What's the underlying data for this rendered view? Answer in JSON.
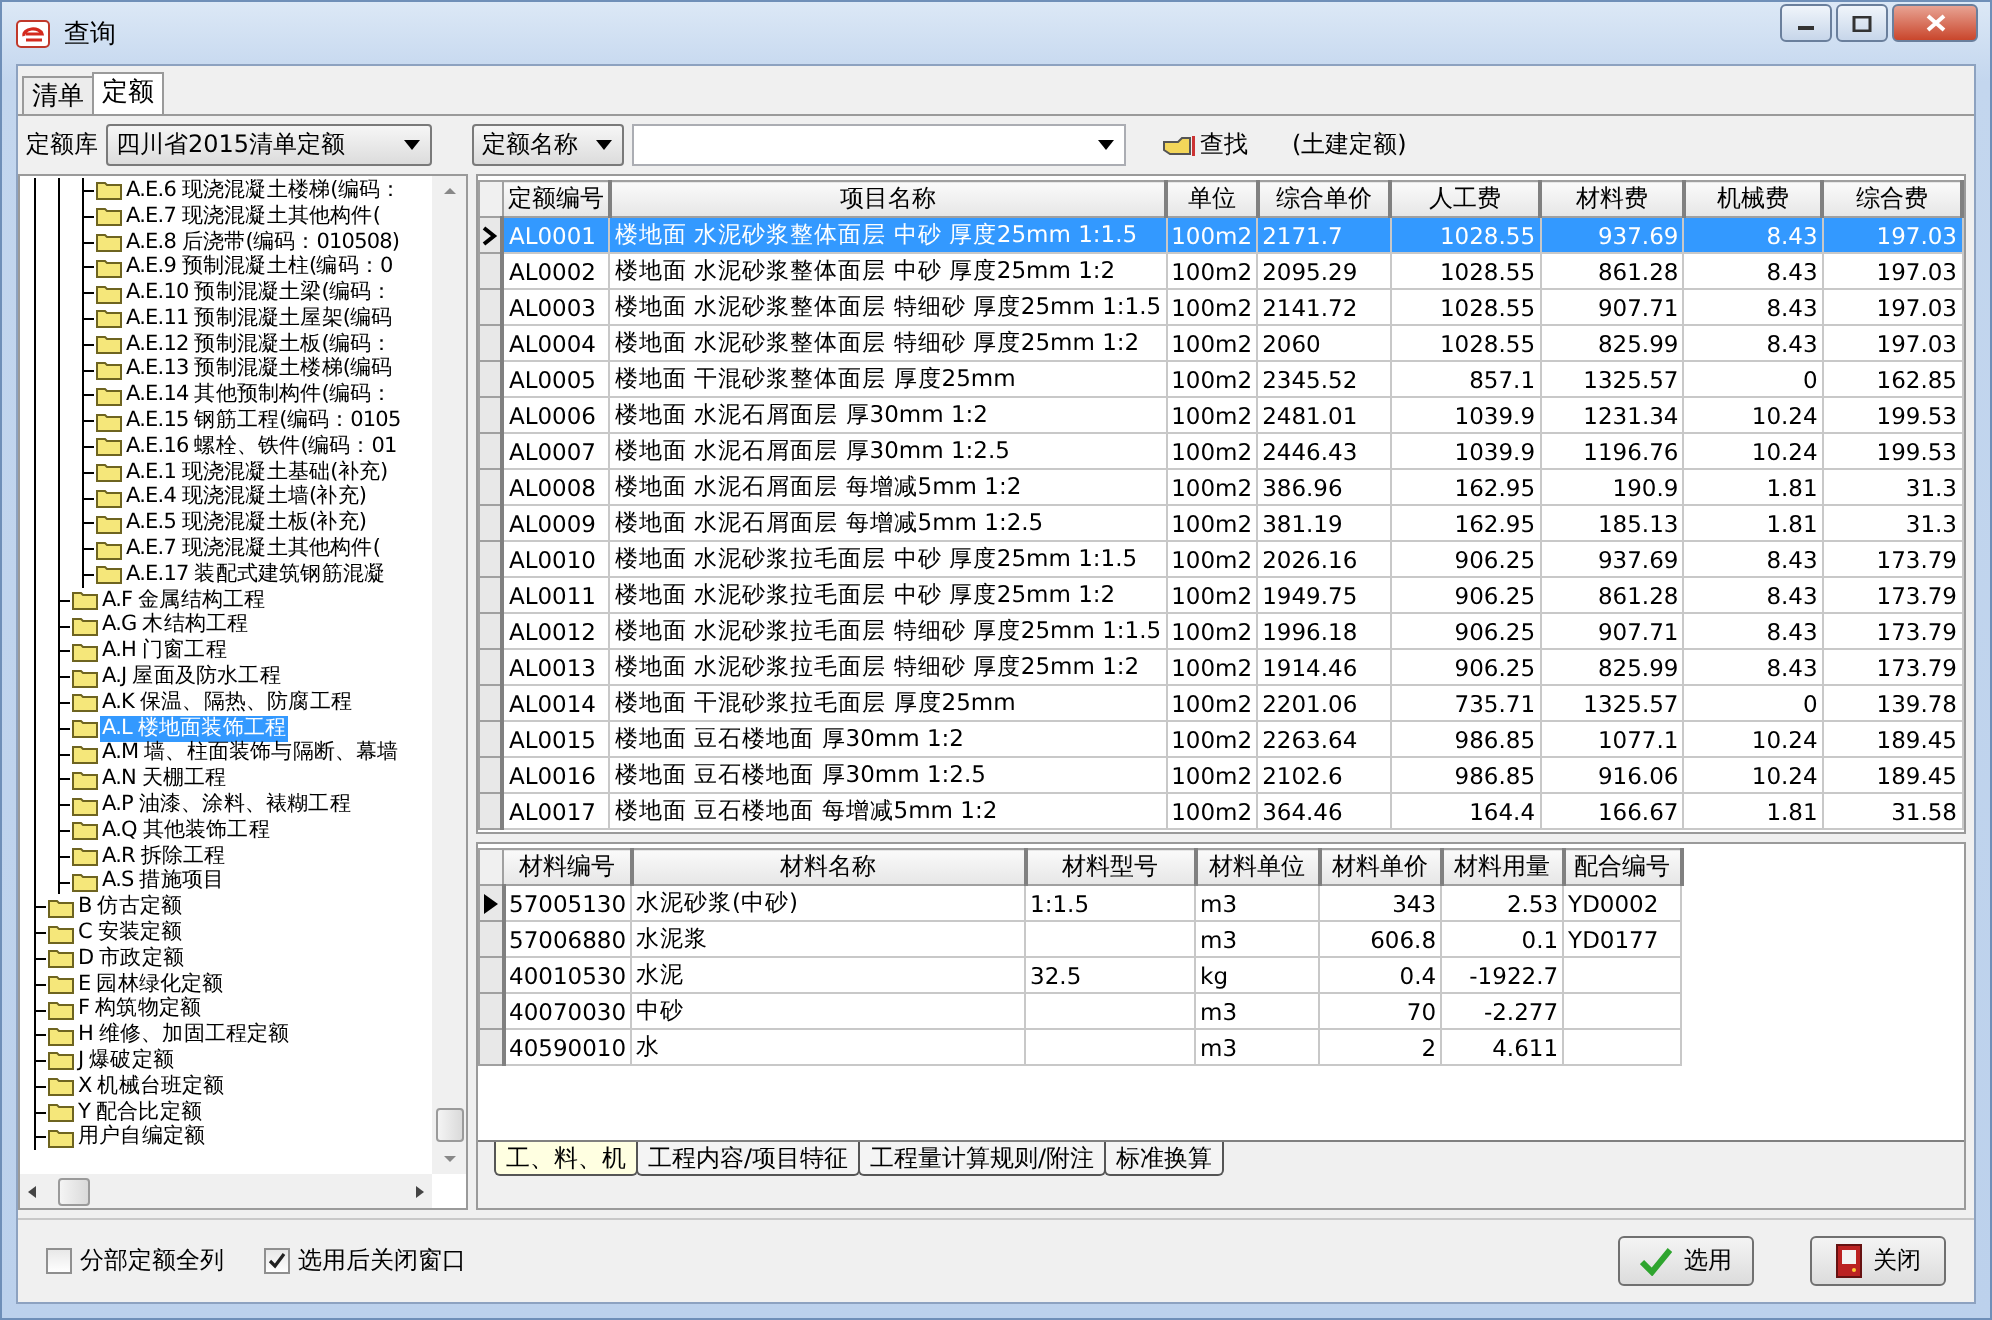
{
  "window": {
    "title": "查询"
  },
  "tabs": [
    {
      "label": "清单",
      "selected": false
    },
    {
      "label": "定额",
      "selected": true
    }
  ],
  "toolbar": {
    "library_label": "定额库",
    "library_value": "四川省2015清单定额",
    "field_value": "定额名称",
    "search_button": "查找",
    "note": "(土建定额)"
  },
  "tree": {
    "items": [
      {
        "children": [
          {
            "children": [
              {
                "label": "A.E.6 现浇混凝土楼梯(编码：",
                "selected": false
              },
              {
                "label": "A.E.7 现浇混凝土其他构件(",
                "selected": false
              },
              {
                "label": "A.E.8 后浇带(编码：010508)",
                "selected": false
              },
              {
                "label": "A.E.9 预制混凝土柱(编码：0",
                "selected": false
              },
              {
                "label": "A.E.10 预制混凝土梁(编码：",
                "selected": false
              },
              {
                "label": "A.E.11 预制混凝土屋架(编码",
                "selected": false
              },
              {
                "label": "A.E.12 预制混凝土板(编码：",
                "selected": false
              },
              {
                "label": "A.E.13 预制混凝土楼梯(编码",
                "selected": false
              },
              {
                "label": "A.E.14 其他预制构件(编码：",
                "selected": false
              },
              {
                "label": "A.E.15 钢筋工程(编码：0105",
                "selected": false
              },
              {
                "label": "A.E.16 螺栓、铁件(编码：01",
                "selected": false
              },
              {
                "label": "A.E.1 现浇混凝土基础(补充)",
                "selected": false
              },
              {
                "label": "A.E.4 现浇混凝土墙(补充)",
                "selected": false
              },
              {
                "label": "A.E.5 现浇混凝土板(补充)",
                "selected": false
              },
              {
                "label": "A.E.7 现浇混凝土其他构件(",
                "selected": false
              },
              {
                "label": "A.E.17 装配式建筑钢筋混凝",
                "selected": false
              }
            ]
          },
          {
            "label": "A.F 金属结构工程",
            "selected": false
          },
          {
            "label": "A.G 木结构工程",
            "selected": false
          },
          {
            "label": "A.H 门窗工程",
            "selected": false
          },
          {
            "label": "A.J 屋面及防水工程",
            "selected": false
          },
          {
            "label": "A.K 保温、隔热、防腐工程",
            "selected": false
          },
          {
            "label": "A.L 楼地面装饰工程",
            "selected": true
          },
          {
            "label": "A.M 墙、柱面装饰与隔断、幕墙",
            "selected": false
          },
          {
            "label": "A.N 天棚工程",
            "selected": false
          },
          {
            "label": "A.P 油漆、涂料、裱糊工程",
            "selected": false
          },
          {
            "label": "A.Q 其他装饰工程",
            "selected": false
          },
          {
            "label": "A.R 拆除工程",
            "selected": false
          },
          {
            "label": "A.S 措施项目",
            "selected": false
          }
        ]
      },
      {
        "label": "B 仿古定额",
        "selected": false
      },
      {
        "label": "C 安装定额",
        "selected": false
      },
      {
        "label": "D 市政定额",
        "selected": false
      },
      {
        "label": "E 园林绿化定额",
        "selected": false
      },
      {
        "label": "F 构筑物定额",
        "selected": false
      },
      {
        "label": "H 维修、加固工程定额",
        "selected": false
      },
      {
        "label": "J 爆破定额",
        "selected": false
      },
      {
        "label": "X 机械台班定额",
        "selected": false
      },
      {
        "label": "Y 配合比定额",
        "selected": false
      },
      {
        "label": "用户自编定额",
        "selected": false
      }
    ]
  },
  "items_table": {
    "columns": [
      "定额编号",
      "项目名称",
      "单位",
      "综合单价",
      "人工费",
      "材料费",
      "机械费",
      "综合费"
    ],
    "rows": [
      {
        "selected": true,
        "cells": [
          "AL0001",
          "楼地面 水泥砂浆整体面层 中砂 厚度25mm 1:1.5",
          "100m2",
          "2171.7",
          "1028.55",
          "937.69",
          "8.43",
          "197.03"
        ]
      },
      {
        "selected": false,
        "cells": [
          "AL0002",
          "楼地面 水泥砂浆整体面层 中砂 厚度25mm 1:2",
          "100m2",
          "2095.29",
          "1028.55",
          "861.28",
          "8.43",
          "197.03"
        ]
      },
      {
        "selected": false,
        "cells": [
          "AL0003",
          "楼地面 水泥砂浆整体面层 特细砂 厚度25mm 1:1.5",
          "100m2",
          "2141.72",
          "1028.55",
          "907.71",
          "8.43",
          "197.03"
        ]
      },
      {
        "selected": false,
        "cells": [
          "AL0004",
          "楼地面 水泥砂浆整体面层 特细砂 厚度25mm 1:2",
          "100m2",
          "2060",
          "1028.55",
          "825.99",
          "8.43",
          "197.03"
        ]
      },
      {
        "selected": false,
        "cells": [
          "AL0005",
          "楼地面 干混砂浆整体面层 厚度25mm",
          "100m2",
          "2345.52",
          "857.1",
          "1325.57",
          "0",
          "162.85"
        ]
      },
      {
        "selected": false,
        "cells": [
          "AL0006",
          "楼地面 水泥石屑面层 厚30mm 1:2",
          "100m2",
          "2481.01",
          "1039.9",
          "1231.34",
          "10.24",
          "199.53"
        ]
      },
      {
        "selected": false,
        "cells": [
          "AL0007",
          "楼地面 水泥石屑面层 厚30mm 1:2.5",
          "100m2",
          "2446.43",
          "1039.9",
          "1196.76",
          "10.24",
          "199.53"
        ]
      },
      {
        "selected": false,
        "cells": [
          "AL0008",
          "楼地面 水泥石屑面层 每增减5mm 1:2",
          "100m2",
          "386.96",
          "162.95",
          "190.9",
          "1.81",
          "31.3"
        ]
      },
      {
        "selected": false,
        "cells": [
          "AL0009",
          "楼地面 水泥石屑面层 每增减5mm 1:2.5",
          "100m2",
          "381.19",
          "162.95",
          "185.13",
          "1.81",
          "31.3"
        ]
      },
      {
        "selected": false,
        "cells": [
          "AL0010",
          "楼地面 水泥砂浆拉毛面层 中砂 厚度25mm 1:1.5",
          "100m2",
          "2026.16",
          "906.25",
          "937.69",
          "8.43",
          "173.79"
        ]
      },
      {
        "selected": false,
        "cells": [
          "AL0011",
          "楼地面 水泥砂浆拉毛面层 中砂 厚度25mm 1:2",
          "100m2",
          "1949.75",
          "906.25",
          "861.28",
          "8.43",
          "173.79"
        ]
      },
      {
        "selected": false,
        "cells": [
          "AL0012",
          "楼地面 水泥砂浆拉毛面层 特细砂 厚度25mm 1:1.5",
          "100m2",
          "1996.18",
          "906.25",
          "907.71",
          "8.43",
          "173.79"
        ]
      },
      {
        "selected": false,
        "cells": [
          "AL0013",
          "楼地面 水泥砂浆拉毛面层 特细砂 厚度25mm 1:2",
          "100m2",
          "1914.46",
          "906.25",
          "825.99",
          "8.43",
          "173.79"
        ]
      },
      {
        "selected": false,
        "cells": [
          "AL0014",
          "楼地面 干混砂浆拉毛面层 厚度25mm",
          "100m2",
          "2201.06",
          "735.71",
          "1325.57",
          "0",
          "139.78"
        ]
      },
      {
        "selected": false,
        "cells": [
          "AL0015",
          "楼地面 豆石楼地面 厚30mm 1:2",
          "100m2",
          "2263.64",
          "986.85",
          "1077.1",
          "10.24",
          "189.45"
        ]
      },
      {
        "selected": false,
        "cells": [
          "AL0016",
          "楼地面 豆石楼地面 厚30mm 1:2.5",
          "100m2",
          "2102.6",
          "986.85",
          "916.06",
          "10.24",
          "189.45"
        ]
      },
      {
        "selected": false,
        "cells": [
          "AL0017",
          "楼地面 豆石楼地面 每增减5mm 1:2",
          "100m2",
          "364.46",
          "164.4",
          "166.67",
          "1.81",
          "31.58"
        ]
      }
    ]
  },
  "materials_table": {
    "columns": [
      "材料编号",
      "材料名称",
      "材料型号",
      "材料单位",
      "材料单价",
      "材料用量",
      "配合编号"
    ],
    "rows": [
      {
        "selected": true,
        "cells": [
          "57005130",
          "水泥砂浆(中砂)",
          "1:1.5",
          "m3",
          "343",
          "2.53",
          "YD0002"
        ]
      },
      {
        "selected": false,
        "cells": [
          "57006880",
          "水泥浆",
          null,
          "m3",
          "606.8",
          "0.1",
          "YD0177"
        ]
      },
      {
        "selected": false,
        "cells": [
          "40010530",
          "水泥",
          "32.5",
          "kg",
          "0.4",
          "-1922.7",
          null
        ]
      },
      {
        "selected": false,
        "cells": [
          "40070030",
          "中砂",
          null,
          "m3",
          "70",
          "-2.277",
          null
        ]
      },
      {
        "selected": false,
        "cells": [
          "40590010",
          "水",
          null,
          "m3",
          "2",
          "4.611",
          null
        ]
      }
    ]
  },
  "bottom_tabs": [
    {
      "label": "工、料、机",
      "selected": true
    },
    {
      "label": "工程内容/项目特征",
      "selected": false
    },
    {
      "label": "工程量计算规则/附注",
      "selected": false
    },
    {
      "label": "标准换算",
      "selected": false
    }
  ],
  "options": [
    {
      "label": "分部定额全列",
      "checked": false
    },
    {
      "label": "选用后关闭窗口",
      "checked": true
    }
  ],
  "buttons": [
    {
      "label": "选用",
      "kind": "confirm"
    },
    {
      "label": "关闭",
      "kind": "close"
    }
  ]
}
